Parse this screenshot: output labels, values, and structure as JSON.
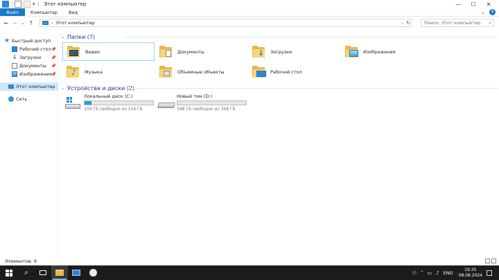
{
  "window": {
    "title": "Этот компьютер",
    "controls": [
      "minimize",
      "maximize",
      "close"
    ]
  },
  "ribbon": {
    "tabs": [
      "Файл",
      "Компьютер",
      "Вид"
    ]
  },
  "address": {
    "path": "Этот компьютер",
    "search_placeholder": "Поиск: Этот компьютер"
  },
  "nav": {
    "items": [
      {
        "label": "Быстрый доступ",
        "icon": "star-icon",
        "pinned": false
      },
      {
        "label": "Рабочий стол",
        "icon": "desktop-icon",
        "pinned": true
      },
      {
        "label": "Загрузки",
        "icon": "downloads-icon",
        "pinned": true
      },
      {
        "label": "Документы",
        "icon": "documents-icon",
        "pinned": true
      },
      {
        "label": "Изображения",
        "icon": "pictures-icon",
        "pinned": true
      },
      {
        "label": "Этот компьютер",
        "icon": "this-pc-icon",
        "selected": true
      },
      {
        "label": "Сеть",
        "icon": "network-icon"
      }
    ],
    "pin_glyph": "📌"
  },
  "folders": {
    "header": "Папки (7)",
    "items": [
      {
        "label": "Видео",
        "icon": "videos-folder-icon"
      },
      {
        "label": "Документы",
        "icon": "documents-folder-icon"
      },
      {
        "label": "Загрузки",
        "icon": "downloads-folder-icon"
      },
      {
        "label": "Изображения",
        "icon": "pictures-folder-icon"
      },
      {
        "label": "Музыка",
        "icon": "music-folder-icon"
      },
      {
        "label": "Объемные объекты",
        "icon": "3d-objects-folder-icon"
      },
      {
        "label": "Рабочий стол",
        "icon": "desktop-folder-icon"
      }
    ]
  },
  "drives": {
    "header": "Устройства и диски (2)",
    "items": [
      {
        "name": "Локальный диск (C:)",
        "free": "104 ГБ свободно из 116 ГБ",
        "used_fraction": 0.1,
        "icon": "system-drive-icon"
      },
      {
        "name": "Новый том (D:)",
        "free": "348 ГБ свободно из 348 ГБ",
        "used_fraction": 0.0,
        "icon": "drive-icon"
      }
    ]
  },
  "status": {
    "count": "Элементов: 9"
  },
  "taskbar": {
    "lang": "ENG",
    "time": "19:35",
    "date": "08.08.2024"
  },
  "colors": {
    "accent": "#1979ca",
    "selection": "#cce8ff",
    "group_header": "#1e3287",
    "drive_bar": "#26a0da",
    "folder": "#e8b74a"
  }
}
